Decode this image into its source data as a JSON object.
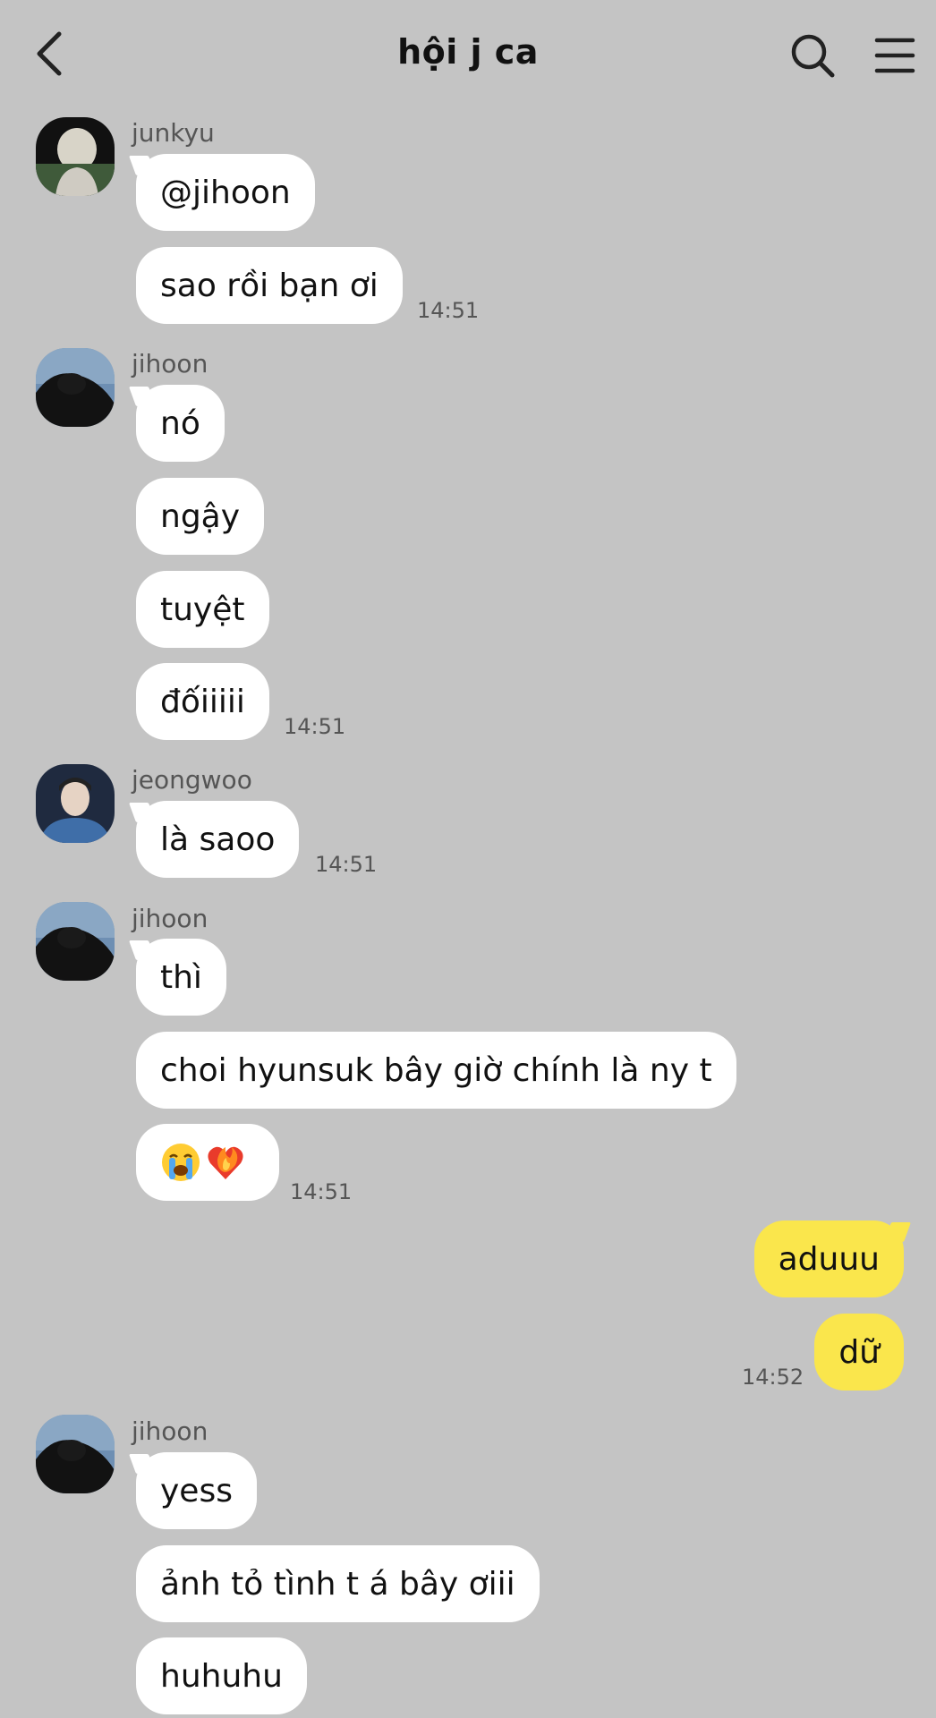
{
  "header": {
    "title": "hội j ca"
  },
  "messages": [
    {
      "sender": "junkyu",
      "bubbles": [
        "@jihoon",
        "sao rồi bạn ơi"
      ],
      "time": "14:51"
    },
    {
      "sender": "jihoon",
      "bubbles": [
        "nó",
        "ngậy",
        "tuyệt",
        "đốiiiii"
      ],
      "time": "14:51"
    },
    {
      "sender": "jeongwoo",
      "bubbles": [
        "là saoo"
      ],
      "time": "14:51"
    },
    {
      "sender": "jihoon",
      "bubbles": [
        "thì",
        "choi hyunsuk bây giờ chính là ny t"
      ],
      "time": "14:51"
    },
    {
      "me": true,
      "bubbles": [
        "aduuu",
        "dữ"
      ],
      "time": "14:52"
    },
    {
      "sender": "jihoon",
      "bubbles": [
        "yess",
        "ảnh tỏ tình t á bây ơiii",
        "huhuhu"
      ]
    }
  ],
  "emoji_message": {
    "icons": [
      "loudly-crying-face-icon",
      "heart-on-fire-icon"
    ]
  },
  "colors": {
    "background": "#c4c4c4",
    "incoming_bubble": "#ffffff",
    "outgoing_bubble": "#fae64c"
  }
}
